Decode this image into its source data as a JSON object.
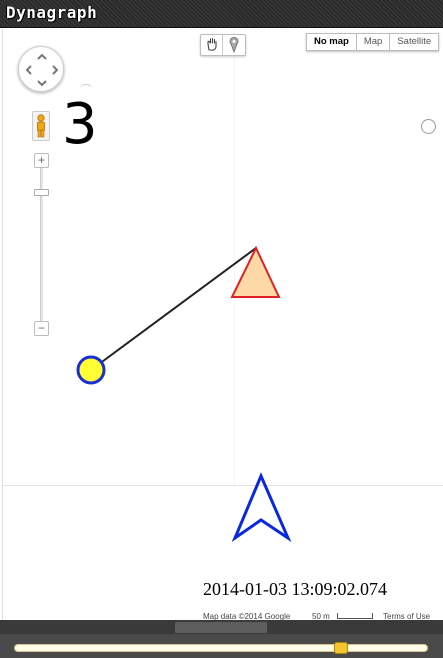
{
  "app": {
    "title": "Dynagraph"
  },
  "map": {
    "map_types": [
      "No map",
      "Map",
      "Satellite"
    ],
    "selected_map_type": "No map",
    "zoom_in_label": "+",
    "zoom_out_label": "−",
    "count": "3",
    "timestamp": "2014-01-03 13:09:02.074",
    "attribution": "Map data ©2014 Google",
    "scale_label": "50 m",
    "terms_label": "Terms of Use"
  },
  "tools": [
    {
      "icon": "hand-icon"
    },
    {
      "icon": "marker-icon"
    }
  ],
  "shapes": {
    "circle": {
      "fill": "#ffff33",
      "stroke": "#1a2ed6"
    },
    "triangle": {
      "fill": "#fcd9a6",
      "stroke": "#e22222"
    },
    "arrow": {
      "stroke": "#0a28e0"
    },
    "link": {
      "stroke": "#222222"
    }
  },
  "timeline": {
    "position_fraction": 0.79
  }
}
